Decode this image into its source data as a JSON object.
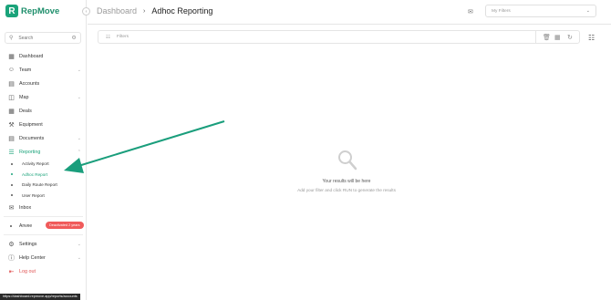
{
  "brand": {
    "name": "RepMove"
  },
  "search": {
    "placeholder": "Search"
  },
  "nav": {
    "dashboard": "Dashboard",
    "team": "Team",
    "accounts": "Accounts",
    "map": "Map",
    "deals": "Deals",
    "equipment": "Equipment",
    "documents": "Documents",
    "reporting": "Reporting",
    "reporting_sub": [
      "Activity Report",
      "Adhoc Report",
      "Daily Route Report",
      "User Report"
    ],
    "inbox": "Inbox",
    "user_name": "Anvee",
    "user_badge": "Deactivated 2 years",
    "settings": "Settings",
    "help_center": "Help Center",
    "logout": "Log out"
  },
  "header": {
    "breadcrumb_root": "Dashboard",
    "breadcrumb_sep": "›",
    "title": "Adhoc Reporting",
    "my_filters_placeholder": "My Filters"
  },
  "filterbar": {
    "label": "Filters"
  },
  "empty_state": {
    "title": "Your results will be here",
    "subtitle": "Add your filter and click RUN to generate the results"
  },
  "status_url": "https://dashboard.repmove.app/reports/accounts",
  "colors": {
    "brand": "#1aa37a",
    "badge": "#f05a5a",
    "arrow": "#1a9e7c",
    "logout": "#e05050"
  },
  "icons": {
    "dashboard": "dashboard-icon",
    "team": "team-icon",
    "accounts": "accounts-icon",
    "map": "map-icon",
    "deals": "deals-icon",
    "equipment": "equipment-icon",
    "documents": "documents-icon",
    "reporting": "reporting-icon",
    "inbox": "inbox-icon",
    "settings": "settings-icon",
    "help": "help-icon",
    "logout": "logout-icon"
  }
}
